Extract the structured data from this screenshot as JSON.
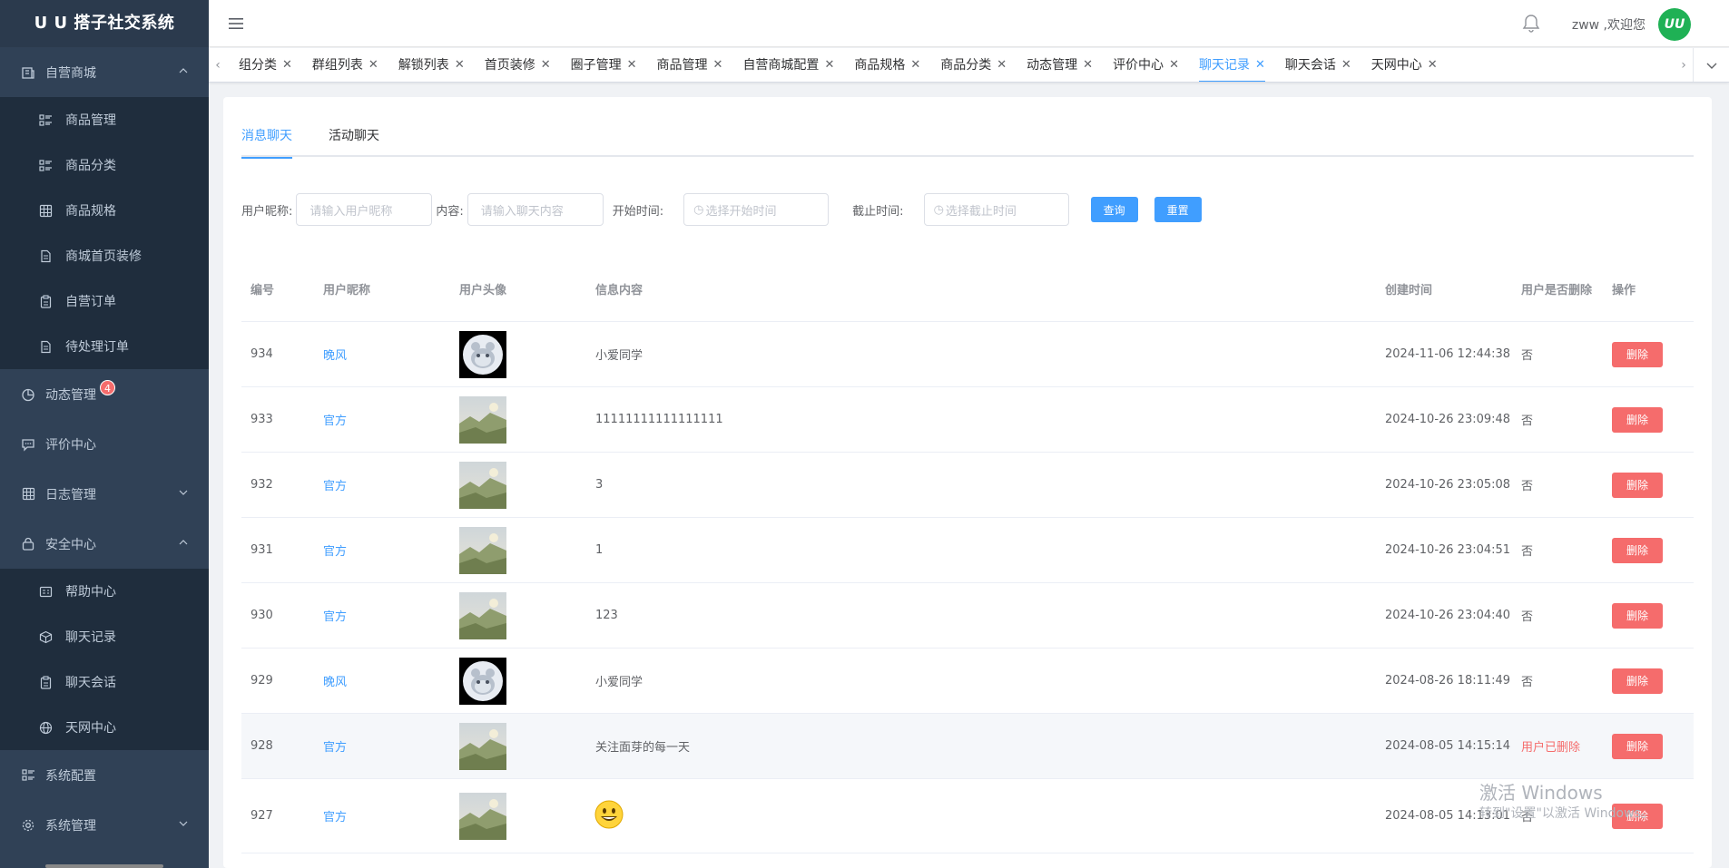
{
  "app": {
    "title": "U U 搭子社交系统"
  },
  "sidebar": {
    "groups": [
      {
        "label": "自营商城",
        "icon": "store-icon",
        "expanded": true,
        "items": [
          {
            "label": "商品管理",
            "icon": "list-icon"
          },
          {
            "label": "商品分类",
            "icon": "list-icon"
          },
          {
            "label": "商品规格",
            "icon": "grid-icon"
          },
          {
            "label": "商城首页装修",
            "icon": "document-icon"
          },
          {
            "label": "自营订单",
            "icon": "clipboard-icon"
          },
          {
            "label": "待处理订单",
            "icon": "document-icon"
          }
        ]
      },
      {
        "label": "动态管理",
        "icon": "pie-chart-icon",
        "badge": "4"
      },
      {
        "label": "评价中心",
        "icon": "chat-icon"
      },
      {
        "label": "日志管理",
        "icon": "grid-icon",
        "expanded": false
      },
      {
        "label": "安全中心",
        "icon": "lock-icon",
        "expanded": true,
        "items": [
          {
            "label": "帮助中心",
            "icon": "id-card-icon"
          },
          {
            "label": "聊天记录",
            "icon": "box-icon"
          },
          {
            "label": "聊天会话",
            "icon": "clipboard-icon"
          },
          {
            "label": "天网中心",
            "icon": "globe-icon"
          }
        ]
      },
      {
        "label": "系统配置",
        "icon": "list-icon"
      },
      {
        "label": "系统管理",
        "icon": "gear-icon",
        "expanded": false
      }
    ]
  },
  "header": {
    "welcome": "zww ,欢迎您",
    "avatar_text": "UU",
    "brand_color": "#1fb155"
  },
  "tabs": [
    {
      "label": "组分类",
      "active": false
    },
    {
      "label": "群组列表",
      "active": false
    },
    {
      "label": "解锁列表",
      "active": false
    },
    {
      "label": "首页装修",
      "active": false
    },
    {
      "label": "圈子管理",
      "active": false
    },
    {
      "label": "商品管理",
      "active": false
    },
    {
      "label": "自营商城配置",
      "active": false
    },
    {
      "label": "商品规格",
      "active": false
    },
    {
      "label": "商品分类",
      "active": false
    },
    {
      "label": "动态管理",
      "active": false
    },
    {
      "label": "评价中心",
      "active": false
    },
    {
      "label": "聊天记录",
      "active": true
    },
    {
      "label": "聊天会话",
      "active": false
    },
    {
      "label": "天网中心",
      "active": false
    }
  ],
  "subtabs": [
    {
      "label": "消息聊天",
      "active": true
    },
    {
      "label": "活动聊天",
      "active": false
    }
  ],
  "filters": {
    "nickname_label": "用户昵称:",
    "nickname_placeholder": "请输入用户昵称",
    "content_label": "内容:",
    "content_placeholder": "请输入聊天内容",
    "start_label": "开始时间:",
    "start_placeholder": "选择开始时间",
    "end_label": "截止时间:",
    "end_placeholder": "选择截止时间",
    "query_label": "查询",
    "reset_label": "重置"
  },
  "table": {
    "columns": [
      "编号",
      "用户昵称",
      "用户头像",
      "信息内容",
      "创建时间",
      "用户是否删除",
      "操作"
    ],
    "delete_label": "删除",
    "rows": [
      {
        "id": "934",
        "nickname": "晚风",
        "avatar": "cartoon",
        "content": "小爱同学",
        "created": "2024-11-06 12:44:38",
        "deleted": "否",
        "deleted_flag": false
      },
      {
        "id": "933",
        "nickname": "官方",
        "avatar": "landscape",
        "content": "11111111111111111",
        "created": "2024-10-26 23:09:48",
        "deleted": "否",
        "deleted_flag": false
      },
      {
        "id": "932",
        "nickname": "官方",
        "avatar": "landscape",
        "content": "3",
        "created": "2024-10-26 23:05:08",
        "deleted": "否",
        "deleted_flag": false
      },
      {
        "id": "931",
        "nickname": "官方",
        "avatar": "landscape",
        "content": "1",
        "created": "2024-10-26 23:04:51",
        "deleted": "否",
        "deleted_flag": false
      },
      {
        "id": "930",
        "nickname": "官方",
        "avatar": "landscape",
        "content": "123",
        "created": "2024-10-26 23:04:40",
        "deleted": "否",
        "deleted_flag": false
      },
      {
        "id": "929",
        "nickname": "晚风",
        "avatar": "cartoon",
        "content": "小爱同学",
        "created": "2024-08-26 18:11:49",
        "deleted": "否",
        "deleted_flag": false
      },
      {
        "id": "928",
        "nickname": "官方",
        "avatar": "landscape",
        "content": "关注面芽的每一天",
        "created": "2024-08-05 14:15:14",
        "deleted": "用户已删除",
        "deleted_flag": true,
        "highlight": true
      },
      {
        "id": "927",
        "nickname": "官方",
        "avatar": "landscape",
        "content": "",
        "content_emoji": "smiley",
        "created": "2024-08-05 14:13:01",
        "deleted": "否",
        "deleted_flag": false
      }
    ]
  },
  "watermark": {
    "line1": "激活 Windows",
    "line2": "转到\"设置\"以激活 Windows。"
  }
}
